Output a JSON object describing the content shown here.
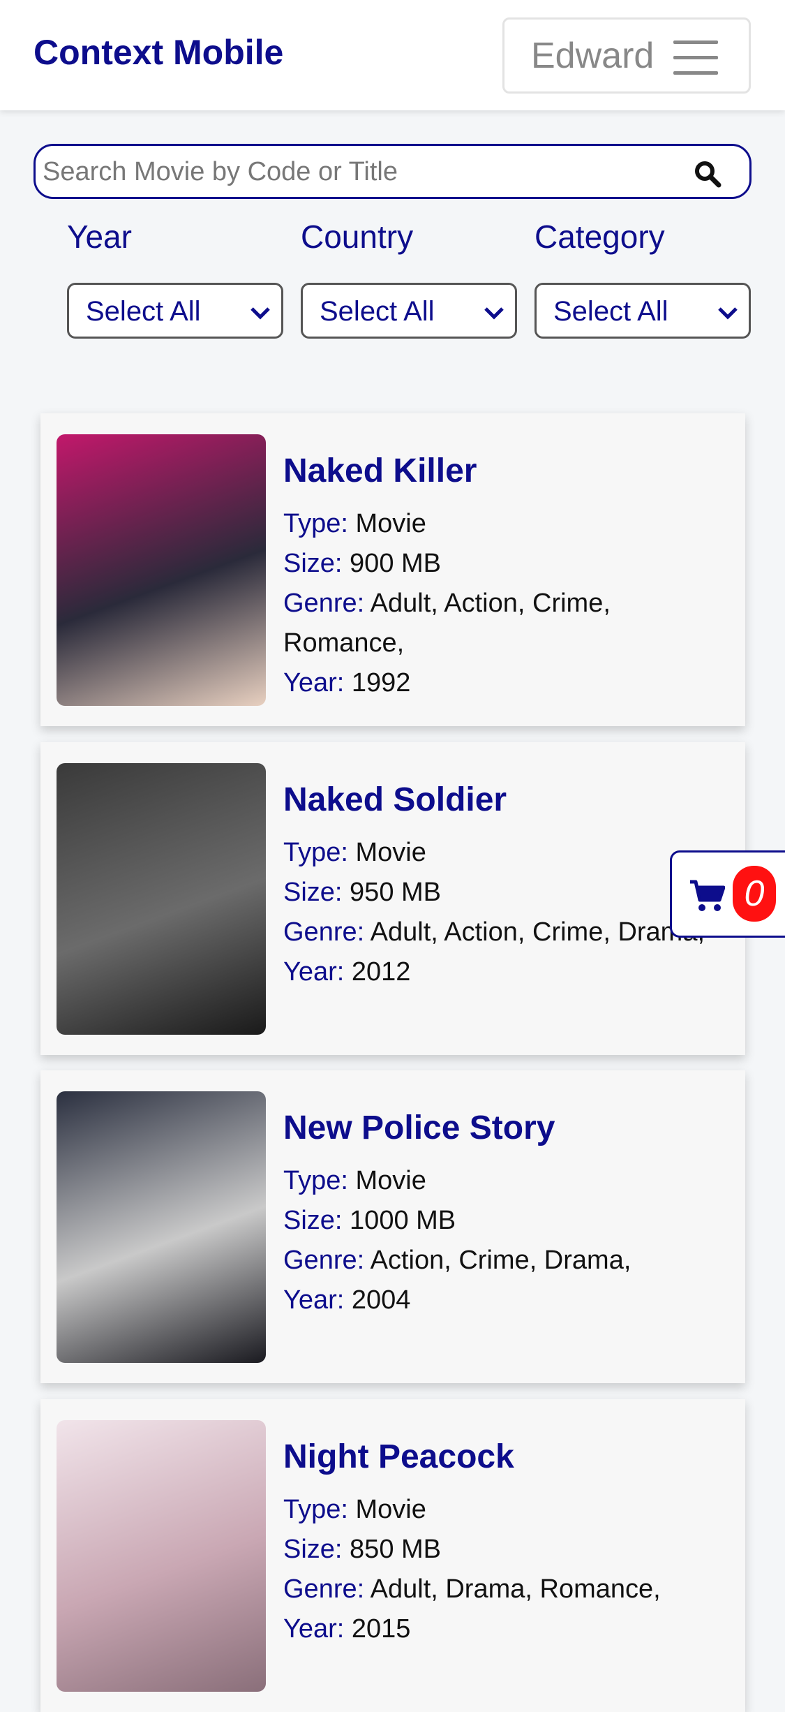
{
  "navbar": {
    "brand": "Context Mobile",
    "user_name": "Edward",
    "menu_icon": "hamburger-icon"
  },
  "search": {
    "placeholder": "Search Movie by Code or Title",
    "value": "",
    "icon": "search-icon"
  },
  "filters": [
    {
      "label": "Year",
      "selected": "Select All"
    },
    {
      "label": "Country",
      "selected": "Select All"
    },
    {
      "label": "Category",
      "selected": "Select All"
    }
  ],
  "field_labels": {
    "type": "Type:",
    "size": "Size:",
    "genre": "Genre:",
    "year": "Year:"
  },
  "movies": [
    {
      "title": "Naked Killer",
      "type": "Movie",
      "size": "900 MB",
      "genre": "Adult, Action, Crime, Romance,",
      "year": "1992",
      "poster_colors": [
        "#c2186b",
        "#2a2a3a",
        "#e8d0c0"
      ]
    },
    {
      "title": "Naked Soldier",
      "type": "Movie",
      "size": "950 MB",
      "genre": "Adult, Action, Crime, Drama,",
      "year": "2012",
      "poster_colors": [
        "#3a3a3a",
        "#6b6b6b",
        "#1a1a1a"
      ]
    },
    {
      "title": "New Police Story",
      "type": "Movie",
      "size": "1000 MB",
      "genre": "Action, Crime, Drama,",
      "year": "2004",
      "poster_colors": [
        "#2b3040",
        "#c9c9c9",
        "#1a1a20"
      ]
    },
    {
      "title": "Night Peacock",
      "type": "Movie",
      "size": "850 MB",
      "genre": "Adult, Drama, Romance,",
      "year": "2015",
      "poster_colors": [
        "#f1e4ea",
        "#c9a7b3",
        "#8a6f7a"
      ]
    }
  ],
  "cart": {
    "count": "0",
    "icon": "shopping-cart-icon"
  },
  "colors": {
    "brand": "#0d0d8c",
    "badge": "#ff1111",
    "background": "#f4f6f8"
  }
}
